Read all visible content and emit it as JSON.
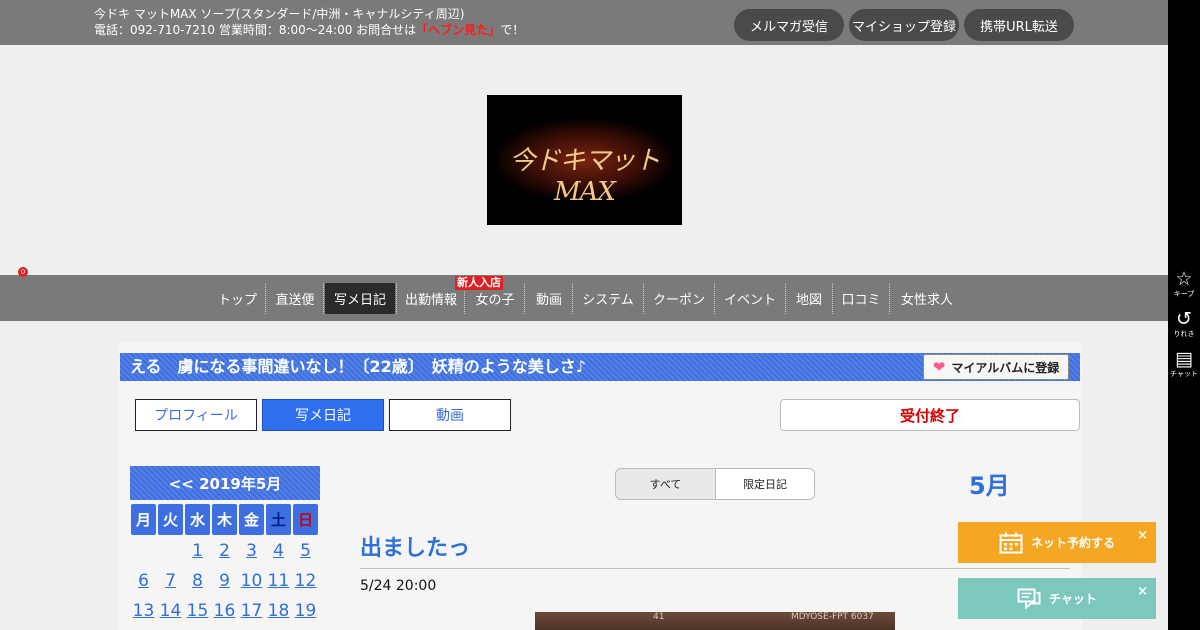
{
  "header": {
    "shop_line": "今ドキ マットMAX ソープ(スタンダード/中洲・キャナルシティ周辺)",
    "contact_prefix": "電話：092-710-7210 営業時間：8:00～24:00 お問合せは",
    "contact_highlight": "「ヘブン見た」",
    "contact_suffix": "で！",
    "buttons": [
      "メルマガ受信",
      "マイショップ登録",
      "携帯URL転送"
    ]
  },
  "logo": {
    "text": "今ドキマットMAX"
  },
  "nav": {
    "items": [
      "トップ",
      "直送便",
      "写メ日記",
      "出勤情報",
      "女の子",
      "動画",
      "システム",
      "クーポン",
      "イベント",
      "地図",
      "口コミ",
      "女性求人"
    ],
    "active": "写メ日記",
    "badge": "新人入店"
  },
  "profile": {
    "banner": "える　虜になる事間違いなし！〔22歳〕　妖精のような美しさ♪",
    "album_button": "マイアルバムに登録",
    "tabs": [
      "プロフィール",
      "写メ日記",
      "動画"
    ],
    "active_tab": "写メ日記",
    "status": "受付終了"
  },
  "calendar": {
    "header": "<< 2019年5月",
    "weekdays": [
      "月",
      "火",
      "水",
      "木",
      "金",
      "土",
      "日"
    ],
    "weeks": [
      [
        "",
        "",
        "1",
        "2",
        "3",
        "4",
        "5"
      ],
      [
        "6",
        "7",
        "8",
        "9",
        "10",
        "11",
        "12"
      ],
      [
        "13",
        "14",
        "15",
        "16",
        "17",
        "18",
        "19"
      ]
    ]
  },
  "diary": {
    "filters": [
      "すべて",
      "限定日記"
    ],
    "month": "5月",
    "post_title": "出ましたっ",
    "post_datetime": "5/24 20:00",
    "photo_text_left": "41",
    "photo_text_right": "MDYOSE-FPT 6037"
  },
  "floating": {
    "reserve": "ネット予約する",
    "chat": "チャット",
    "close": "×"
  },
  "rail": {
    "keep_count": "0",
    "keep_label": "キープ",
    "history_label": "りれき",
    "chat_label": "チャット"
  },
  "colors": {
    "accent_blue": "#3d6fe0",
    "header_gray": "#7a7a7a",
    "status_red": "#d40000",
    "reserve_orange": "#f5a623",
    "chat_teal": "#7cc8bd"
  }
}
